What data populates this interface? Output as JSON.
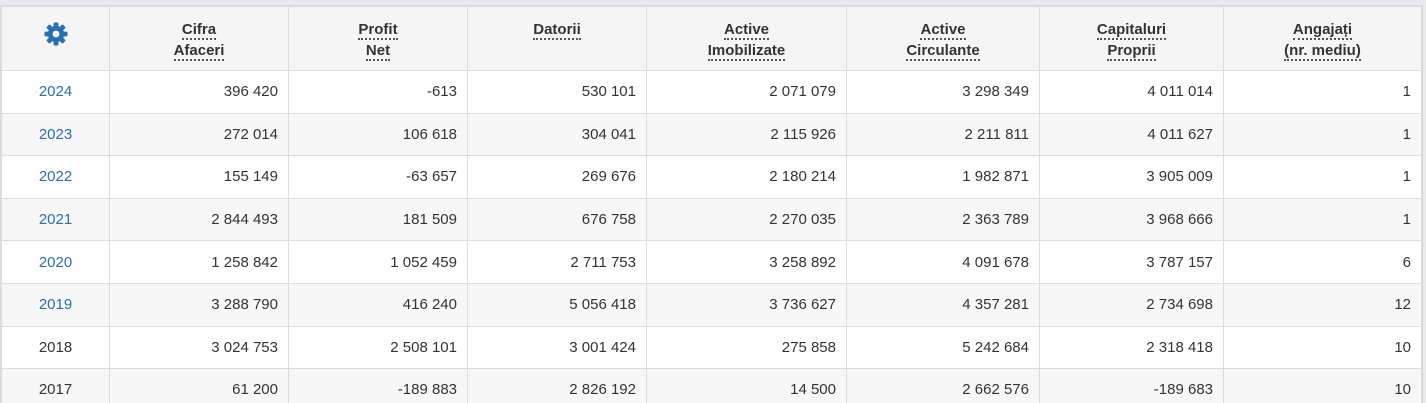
{
  "colors": {
    "gear": "#2a6fb0",
    "year_link": "#2a6fb0"
  },
  "header": {
    "settings_icon": "gear-icon",
    "columns": [
      [
        "Cifra",
        "Afaceri"
      ],
      [
        "Profit",
        "Net"
      ],
      [
        "Datorii"
      ],
      [
        "Active",
        "Imobilizate"
      ],
      [
        "Active",
        "Circulante"
      ],
      [
        "Capitaluri",
        "Proprii"
      ],
      [
        "Angajați",
        "(nr. mediu)"
      ]
    ]
  },
  "rows": [
    {
      "year": "2024",
      "link": true,
      "values": [
        "396 420",
        "-613",
        "530 101",
        "2 071 079",
        "3 298 349",
        "4 011 014",
        "1"
      ]
    },
    {
      "year": "2023",
      "link": true,
      "values": [
        "272 014",
        "106 618",
        "304 041",
        "2 115 926",
        "2 211 811",
        "4 011 627",
        "1"
      ]
    },
    {
      "year": "2022",
      "link": true,
      "values": [
        "155 149",
        "-63 657",
        "269 676",
        "2 180 214",
        "1 982 871",
        "3 905 009",
        "1"
      ]
    },
    {
      "year": "2021",
      "link": true,
      "values": [
        "2 844 493",
        "181 509",
        "676 758",
        "2 270 035",
        "2 363 789",
        "3 968 666",
        "1"
      ]
    },
    {
      "year": "2020",
      "link": true,
      "values": [
        "1 258 842",
        "1 052 459",
        "2 711 753",
        "3 258 892",
        "4 091 678",
        "3 787 157",
        "6"
      ]
    },
    {
      "year": "2019",
      "link": true,
      "values": [
        "3 288 790",
        "416 240",
        "5 056 418",
        "3 736 627",
        "4 357 281",
        "2 734 698",
        "12"
      ]
    },
    {
      "year": "2018",
      "link": false,
      "values": [
        "3 024 753",
        "2 508 101",
        "3 001 424",
        "275 858",
        "5 242 684",
        "2 318 418",
        "10"
      ]
    },
    {
      "year": "2017",
      "link": false,
      "values": [
        "61 200",
        "-189 883",
        "2 826 192",
        "14 500",
        "2 662 576",
        "-189 683",
        "10"
      ]
    }
  ]
}
